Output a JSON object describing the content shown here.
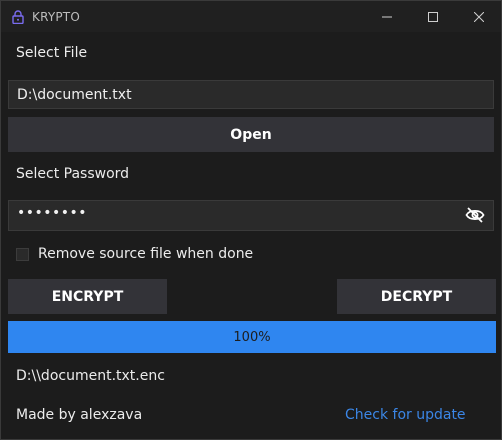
{
  "window": {
    "title": "KRYPTO",
    "icon": "lock-icon"
  },
  "file": {
    "label": "Select File",
    "value": "D:\\document.txt",
    "open_label": "Open"
  },
  "password": {
    "label": "Select Password",
    "masked_value": "••••••••",
    "visibility_icon": "eye-off-icon"
  },
  "options": {
    "remove_source_label": "Remove source file when done",
    "remove_source_checked": false
  },
  "actions": {
    "encrypt_label": "ENCRYPT",
    "decrypt_label": "DECRYPT"
  },
  "progress": {
    "value": 1.0,
    "text": "100%"
  },
  "output": {
    "path": "D:\\\\document.txt.enc"
  },
  "footer": {
    "credit": "Made by alexzava",
    "update_link": "Check for update"
  },
  "colors": {
    "background": "#1c1c1c",
    "field": "#2a2a2a",
    "button": "#333338",
    "accent": "#2f86f0",
    "link": "#3b86e6"
  }
}
